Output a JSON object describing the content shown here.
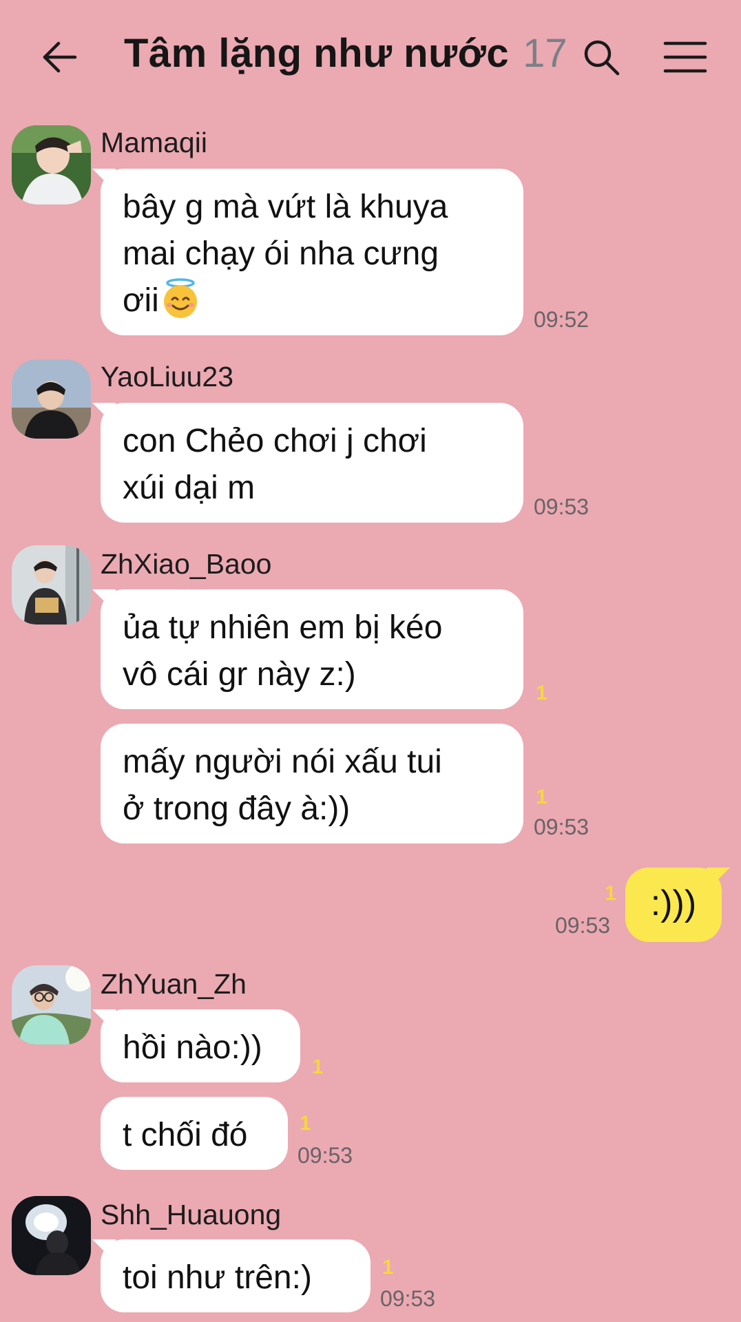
{
  "header": {
    "title": "Tâm lặng như nước",
    "member_count": "17"
  },
  "messages": [
    {
      "sender": "Mamaqii",
      "bubbles": [
        {
          "lines": [
            "bây g mà vứt là khuya",
            "mai chạy ói nha cưng",
            "ơii"
          ],
          "emoji": "smiling-face-with-halo"
        }
      ],
      "time": "09:52"
    },
    {
      "sender": "YaoLiuu23",
      "bubbles": [
        {
          "lines": [
            "con Chẻo chơi j chơi",
            "xúi dại m"
          ]
        }
      ],
      "time": "09:53"
    },
    {
      "sender": "ZhXiao_Baoo",
      "bubbles": [
        {
          "lines": [
            "ủa tự nhiên em bị kéo",
            "vô cái gr này z:)"
          ],
          "unread": "1"
        },
        {
          "lines": [
            "mấy người nói xấu tui",
            "ở trong đây à:))"
          ],
          "unread": "1"
        }
      ],
      "time": "09:53"
    },
    {
      "sender": "me",
      "bubbles": [
        {
          "text": ":)))",
          "unread": "1"
        }
      ],
      "time": "09:53"
    },
    {
      "sender": "ZhYuan_Zh",
      "bubbles": [
        {
          "text": "hồi nào:))",
          "unread": "1"
        },
        {
          "text": "t chối đó",
          "unread": "1"
        }
      ],
      "time": "09:53"
    },
    {
      "sender": "Shh_Huauong",
      "bubbles": [
        {
          "text": "toi như trên:)",
          "unread": "1"
        }
      ],
      "time": "09:53"
    }
  ],
  "colors": {
    "background": "#eba9b2",
    "incoming_bubble": "#ffffff",
    "outgoing_bubble": "#fbe84f",
    "unread_badge": "#f4d73f",
    "member_count": "#7b7f86"
  }
}
